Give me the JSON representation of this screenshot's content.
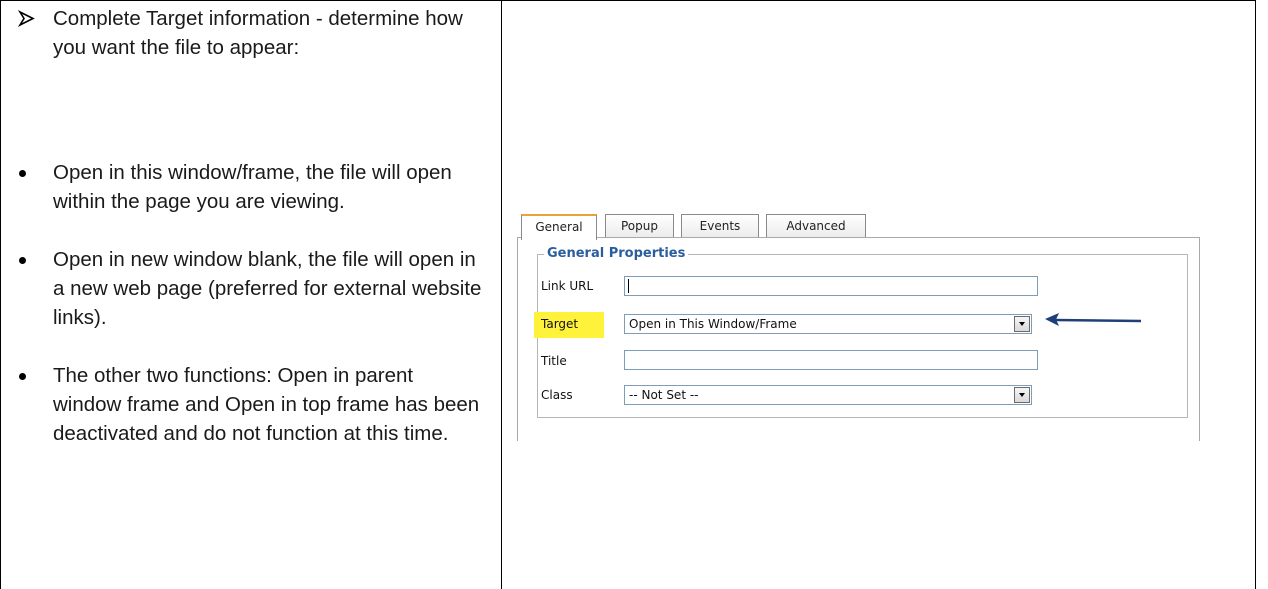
{
  "left_cell": {
    "intro": "Complete Target information - determine how you want the file to appear:",
    "bullets": [
      "Open in this window/frame, the file will open within the page you are viewing.",
      "Open in new window blank, the file will open in a new web page (preferred for external website links).",
      "The other two functions: Open in parent window frame and Open in top frame has been deactivated and do not function at this time."
    ],
    "marker_icon": "arrow-bullet-icon"
  },
  "dialog": {
    "tabs": [
      "General",
      "Popup",
      "Events",
      "Advanced"
    ],
    "active_tab": "General",
    "legend": "General Properties",
    "fields": {
      "link_url": {
        "label": "Link URL",
        "value": ""
      },
      "target": {
        "label": "Target",
        "value": "Open in This Window/Frame"
      },
      "title": {
        "label": "Title",
        "value": ""
      },
      "class": {
        "label": "Class",
        "value": "-- Not Set --"
      }
    },
    "highlight_color": "#fff23a",
    "arrow_color": "#1f3f7a",
    "legend_color": "#2a5d9e",
    "active_tab_accent": "#e8a43a"
  }
}
